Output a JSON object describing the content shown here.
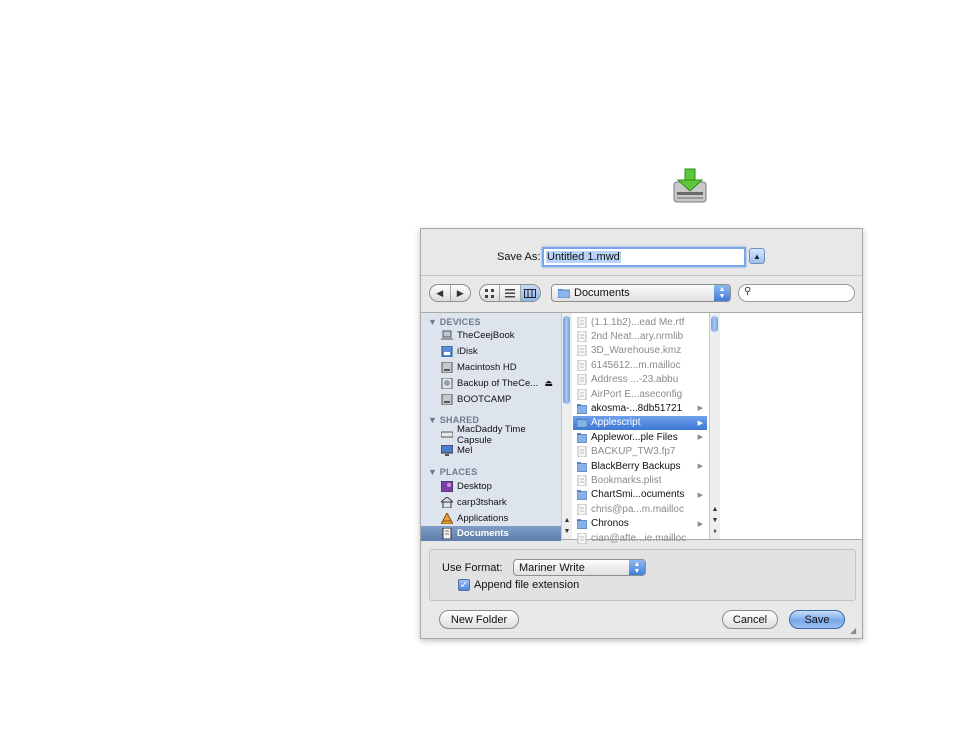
{
  "header": {
    "icon": "download-icon"
  },
  "dialog": {
    "save_as_label": "Save As:",
    "filename_value": "Untitled 1.mwd",
    "expand_icon": "triangle-up-icon",
    "toolbar": {
      "back_icon": "◀",
      "forward_icon": "▶",
      "location": "Documents",
      "search_placeholder": ""
    },
    "sidebar": {
      "devices_header": "▼ DEVICES",
      "devices": [
        {
          "label": "TheCeejBook",
          "icon": "laptop-icon"
        },
        {
          "label": "iDisk",
          "icon": "idisk-icon"
        },
        {
          "label": "Macintosh HD",
          "icon": "hard-drive-icon"
        },
        {
          "label": "Backup of TheCe...",
          "icon": "disk-image-icon"
        },
        {
          "label": "BOOTCAMP",
          "icon": "hard-drive-icon"
        }
      ],
      "shared_header": "▼ SHARED",
      "shared": [
        {
          "label": "MacDaddy Time Capsule",
          "icon": "time-capsule-icon"
        },
        {
          "label": "Mel",
          "icon": "monitor-icon"
        }
      ],
      "places_header": "▼ PLACES",
      "places": [
        {
          "label": "Desktop",
          "icon": "desktop-icon"
        },
        {
          "label": "carp3tshark",
          "icon": "home-icon"
        },
        {
          "label": "Applications",
          "icon": "applications-icon"
        },
        {
          "label": "Documents",
          "icon": "documents-icon"
        }
      ]
    },
    "files": [
      {
        "name": "(1.1.1b2)...ead Me.rtf",
        "dim": true,
        "folder": false
      },
      {
        "name": "2nd Neat...ary.nrmlib",
        "dim": true,
        "folder": false
      },
      {
        "name": "3D_Warehouse.kmz",
        "dim": true,
        "folder": false
      },
      {
        "name": "6145612...m.mailloc",
        "dim": true,
        "folder": false
      },
      {
        "name": "Address ...-23.abbu",
        "dim": true,
        "folder": false
      },
      {
        "name": "AirPort E...aseconfig",
        "dim": true,
        "folder": false
      },
      {
        "name": "akosma-...8db51721",
        "dim": false,
        "folder": true
      },
      {
        "name": "Applescript",
        "dim": false,
        "folder": true,
        "selected": true
      },
      {
        "name": "Applewor...ple Files",
        "dim": false,
        "folder": true
      },
      {
        "name": "BACKUP_TW3.fp7",
        "dim": true,
        "folder": false
      },
      {
        "name": "BlackBerry Backups",
        "dim": false,
        "folder": true
      },
      {
        "name": "Bookmarks.plist",
        "dim": true,
        "folder": false
      },
      {
        "name": "ChartSmi...ocuments",
        "dim": false,
        "folder": true
      },
      {
        "name": "chris@pa...m.mailloc",
        "dim": true,
        "folder": false
      },
      {
        "name": "Chronos",
        "dim": false,
        "folder": true
      },
      {
        "name": "cian@afte...ie.mailloc",
        "dim": true,
        "folder": false
      }
    ],
    "format": {
      "label": "Use Format:",
      "value": "Mariner Write",
      "checkbox_label": "Append file extension",
      "checked": true
    },
    "buttons": {
      "new_folder": "New Folder",
      "cancel": "Cancel",
      "save": "Save"
    }
  }
}
